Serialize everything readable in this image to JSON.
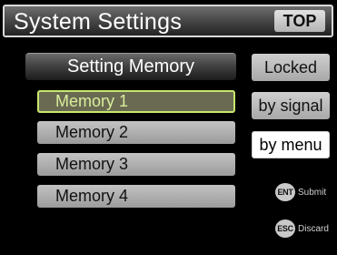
{
  "header": {
    "title": "System Settings",
    "top_label": "TOP"
  },
  "panel": {
    "heading": "Setting Memory",
    "items": [
      {
        "label": "Memory 1",
        "selected": true
      },
      {
        "label": "Memory 2",
        "selected": false
      },
      {
        "label": "Memory 3",
        "selected": false
      },
      {
        "label": "Memory 4",
        "selected": false
      }
    ]
  },
  "side_buttons": [
    {
      "label": "Locked",
      "style": "gray"
    },
    {
      "label": "by signal",
      "style": "gray"
    },
    {
      "label": "by menu",
      "style": "white"
    }
  ],
  "legend": [
    {
      "key": "ENT",
      "label": "Submit",
      "icon": "enter-key-icon"
    },
    {
      "key": "ESC",
      "label": "Discard",
      "icon": "escape-key-icon"
    }
  ],
  "colors": {
    "background": "#000000",
    "selected_border": "#c8e66e",
    "selected_text": "#d8ee9a"
  }
}
